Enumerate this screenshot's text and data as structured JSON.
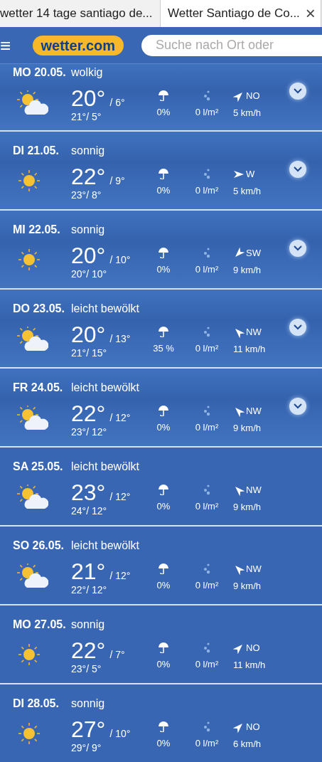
{
  "browser_tabs": [
    {
      "title": "wetter 14 tage santiago de...",
      "selected": false
    },
    {
      "title": "Wetter Santiago de Co...",
      "selected": true,
      "close": "×"
    }
  ],
  "header": {
    "menu": "≡",
    "logo": "wetter.com",
    "search": {
      "placeholder": "Suche nach Ort oder"
    }
  },
  "days": [
    {
      "date": "MO 20.05.",
      "condition": "wolkig",
      "kind": "cloudy",
      "max": "20°",
      "min": "/ 6°",
      "felt": "21°/ 5°",
      "rain_chance": "0%",
      "rain_amount": "0 l/m²",
      "wind": {
        "kind": "ne",
        "direction": "NO",
        "speed": "5 km/h"
      },
      "expandable": true
    },
    {
      "date": "DI 21.05.",
      "condition": "sonnig",
      "kind": "sunny",
      "max": "22°",
      "min": "/ 9°",
      "felt": "23°/ 8°",
      "rain_chance": "0%",
      "rain_amount": "0 l/m²",
      "wind": {
        "kind": "e",
        "direction": "W",
        "speed": "5 km/h"
      },
      "expandable": true
    },
    {
      "date": "MI 22.05.",
      "condition": "sonnig",
      "kind": "sunny",
      "max": "20°",
      "min": "/ 10°",
      "felt": "20°/ 10°",
      "rain_chance": "0%",
      "rain_amount": "0 l/m²",
      "wind": {
        "kind": "sw",
        "direction": "SW",
        "speed": "9 km/h"
      },
      "expandable": true
    },
    {
      "date": "DO 23.05.",
      "condition": "leicht bewölkt",
      "kind": "partly",
      "max": "20°",
      "min": "/ 13°",
      "felt": "21°/ 15°",
      "rain_chance": "35 %",
      "rain_amount": "0 l/m²",
      "wind": {
        "kind": "nw",
        "direction": "NW",
        "speed": "11 km/h"
      },
      "expandable": true
    },
    {
      "date": "FR 24.05.",
      "condition": "leicht bewölkt",
      "kind": "partly",
      "max": "22°",
      "min": "/ 12°",
      "felt": "23°/ 12°",
      "rain_chance": "0%",
      "rain_amount": "0 l/m²",
      "wind": {
        "kind": "nw",
        "direction": "NW",
        "speed": "9 km/h"
      },
      "expandable": true
    },
    {
      "date": "SA 25.05.",
      "condition": "leicht bewölkt",
      "kind": "partly",
      "max": "23°",
      "min": "/ 12°",
      "felt": "24°/ 12°",
      "rain_chance": "0%",
      "rain_amount": "0 l/m²",
      "wind": {
        "kind": "nw",
        "direction": "NW",
        "speed": "9 km/h"
      },
      "expandable": false
    },
    {
      "date": "SO 26.05.",
      "condition": "leicht bewölkt",
      "kind": "partly",
      "max": "21°",
      "min": "/ 12°",
      "felt": "22°/ 12°",
      "rain_chance": "0%",
      "rain_amount": "0 l/m²",
      "wind": {
        "kind": "nw",
        "direction": "NW",
        "speed": "9 km/h"
      },
      "expandable": false
    },
    {
      "date": "MO 27.05.",
      "condition": "sonnig",
      "kind": "sunny",
      "max": "22°",
      "min": "/ 7°",
      "felt": "23°/ 5°",
      "rain_chance": "0%",
      "rain_amount": "0 l/m²",
      "wind": {
        "kind": "ne",
        "direction": "NO",
        "speed": "11 km/h"
      },
      "expandable": false
    },
    {
      "date": "DI 28.05.",
      "condition": "sonnig",
      "kind": "sunny",
      "max": "27°",
      "min": "/ 10°",
      "felt": "29°/ 9°",
      "rain_chance": "0%",
      "rain_amount": "0 l/m²",
      "wind": {
        "kind": "ne",
        "direction": "NO",
        "speed": "6 km/h"
      },
      "expandable": false
    }
  ]
}
